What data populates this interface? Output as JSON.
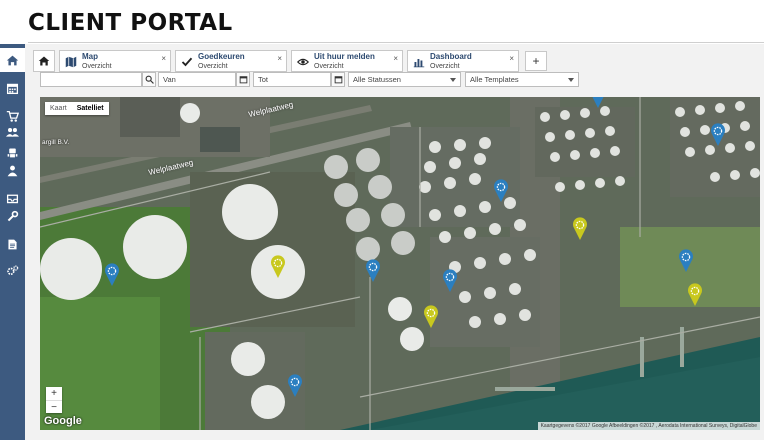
{
  "page": {
    "title": "CLIENT PORTAL"
  },
  "sidebar": {
    "items": [
      {
        "icon": "home-icon",
        "active": true
      },
      {
        "icon": "calendar-icon"
      },
      {
        "icon": "cart-icon"
      },
      {
        "icon": "users-icon"
      },
      {
        "icon": "robot-icon"
      },
      {
        "icon": "user-icon"
      },
      {
        "icon": "inbox-icon"
      },
      {
        "icon": "wrench-icon"
      },
      {
        "icon": "document-icon"
      },
      {
        "icon": "gears-icon"
      }
    ]
  },
  "tabs": [
    {
      "title": "Map",
      "subtitle": "Overzicht",
      "icon": "map-icon"
    },
    {
      "title": "Goedkeuren",
      "subtitle": "Overzicht",
      "icon": "check-icon"
    },
    {
      "title": "Uit huur melden",
      "subtitle": "Overzicht",
      "icon": "eye-icon"
    },
    {
      "title": "Dashboard",
      "subtitle": "Overzicht",
      "icon": "bar-chart-icon"
    }
  ],
  "tab_close_glyph": "×",
  "add_tab_glyph": "+",
  "filters": {
    "search_value": "",
    "from_placeholder": "Van",
    "to_placeholder": "Tot",
    "status_selected": "Alle Statussen",
    "template_selected": "Alle Templates"
  },
  "map": {
    "type_options": [
      "Kaart",
      "Satelliet"
    ],
    "type_selected": "Satelliet",
    "zoom_in": "+",
    "zoom_out": "−",
    "google_logo": "Google",
    "attribution": "Kaartgegevens ©2017 Google Afbeeldingen ©2017 , Aerodata International Surveys, DigitalGlobe",
    "street_labels": [
      "Welplaatweg",
      "Welplaatweg"
    ],
    "poi_label": "argill B.V.",
    "marker_colors": {
      "blue": "#2b7fc0",
      "yellow": "#c8c81e"
    },
    "markers": [
      {
        "color": "blue"
      },
      {
        "color": "yellow"
      },
      {
        "color": "blue"
      },
      {
        "color": "blue"
      },
      {
        "color": "yellow"
      },
      {
        "color": "blue"
      },
      {
        "color": "yellow"
      },
      {
        "color": "blue"
      },
      {
        "color": "blue"
      },
      {
        "color": "yellow"
      },
      {
        "color": "blue"
      },
      {
        "color": "blue"
      }
    ]
  }
}
